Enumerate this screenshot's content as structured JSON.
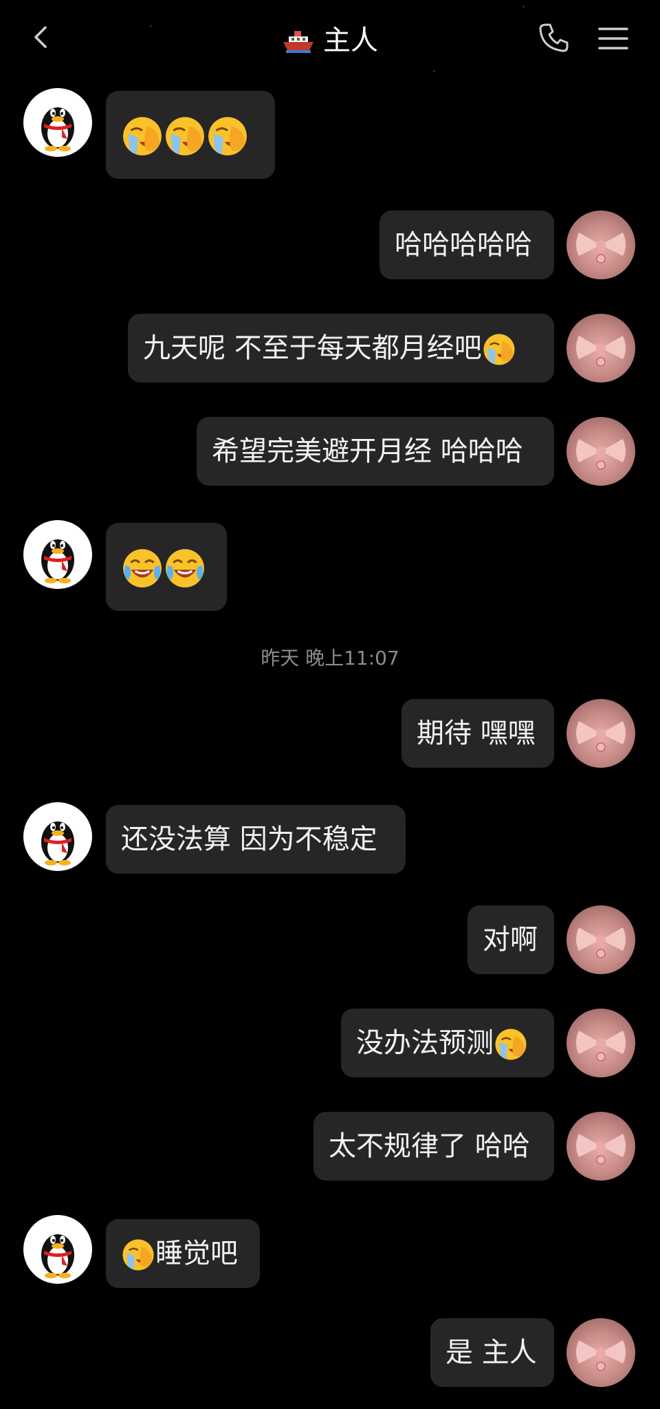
{
  "header": {
    "title": "主人"
  },
  "timestamp": "昨天 晚上11:07",
  "messages": [
    {
      "side": "left",
      "text": ""
    },
    {
      "side": "right",
      "text": "哈哈哈哈哈"
    },
    {
      "side": "right",
      "text": "九天呢 不至于每天都月经吧"
    },
    {
      "side": "right",
      "text": "希望完美避开月经 哈哈哈"
    },
    {
      "side": "left",
      "text": ""
    },
    {
      "side": "right",
      "text": "期待 嘿嘿"
    },
    {
      "side": "left",
      "text": "还没法算 因为不稳定"
    },
    {
      "side": "right",
      "text": "对啊"
    },
    {
      "side": "right",
      "text": "没办法预测"
    },
    {
      "side": "right",
      "text": "太不规律了 哈哈"
    },
    {
      "side": "left",
      "text": "睡觉吧"
    },
    {
      "side": "right",
      "text": "是 主人"
    }
  ],
  "emoji": {
    "facepalm": "facepalm-emoji",
    "tears_of_joy": "tears-of-joy-emoji"
  },
  "colors": {
    "background": "#000000",
    "bubble": "#262626",
    "text": "#f2f2f2"
  }
}
